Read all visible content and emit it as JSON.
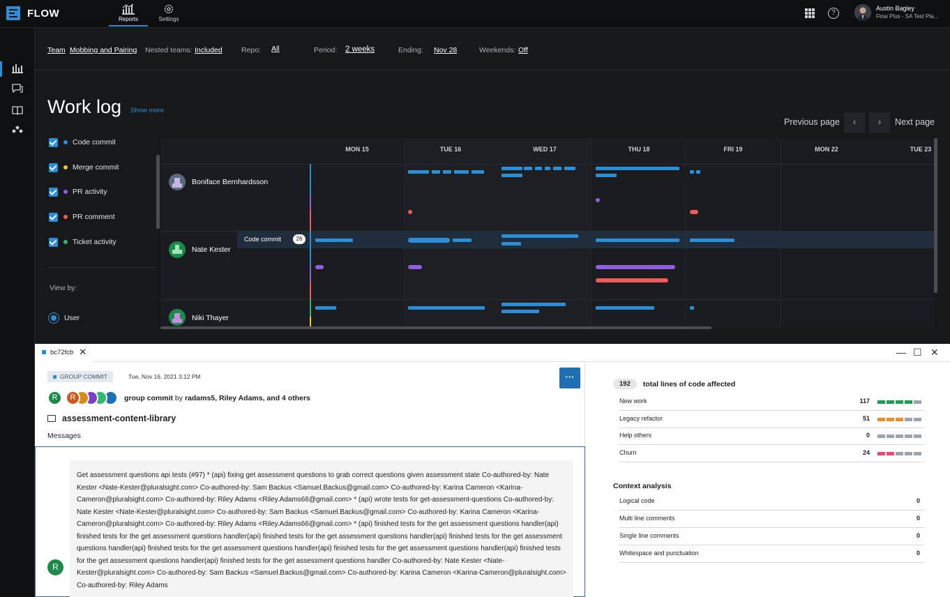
{
  "app": {
    "name": "FLOW"
  },
  "nav": {
    "tabs": [
      {
        "label": "Reports"
      },
      {
        "label": "Settings"
      }
    ]
  },
  "user": {
    "name": "Austin Bagley",
    "subtitle": "Flow Plus - SA Test Pla..."
  },
  "filters": {
    "team_label": "Team",
    "team_value": "Mobbing and Pairing",
    "nested_label": "Nested teams:",
    "nested_value": "Included",
    "repo_label": "Repo:",
    "repo_value": "All",
    "period_label": "Period:",
    "period_value": "2 weeks",
    "ending_label": "Ending:",
    "ending_value": "Nov 28",
    "weekends_label": "Weekends:",
    "weekends_value": "Off"
  },
  "page": {
    "title": "Work log",
    "show_more": "Show more",
    "prev_page": "Previous page",
    "next_page": "Next page",
    "prev_glyph": "‹",
    "next_glyph": "›"
  },
  "legend": [
    {
      "label": "Code commit",
      "color": "#2a8fd6"
    },
    {
      "label": "Merge commit",
      "color": "#f2c230"
    },
    {
      "label": "PR activity",
      "color": "#8e5ee0"
    },
    {
      "label": "PR comment",
      "color": "#ef5a5a"
    },
    {
      "label": "Ticket activity",
      "color": "#2fb86e"
    }
  ],
  "view_by": {
    "label": "View by:",
    "option": "User"
  },
  "days": [
    "MON 15",
    "TUE 16",
    "WED 17",
    "THU 18",
    "FRI 19",
    "MON 22",
    "TUE 23"
  ],
  "users": [
    {
      "name": "Boniface Bernhardsson"
    },
    {
      "name": "Nate Kester"
    },
    {
      "name": "Niki Thayer"
    }
  ],
  "tooltip": {
    "label": "Code commit",
    "count": "26"
  },
  "detail": {
    "tab": "bc72fcb",
    "tab_close": "✕",
    "win_min": "—",
    "win_max": "☐",
    "win_close": "✕",
    "badge": "GROUP COMMIT",
    "date": "Tue, Nov 16, 2021 3:12 PM",
    "more": "···",
    "avatar_letters": [
      "R",
      "R",
      "",
      "",
      "",
      ""
    ],
    "commit_prefix": "group commit",
    "commit_by": "by",
    "commit_authors": "radams5, Riley Adams, and 4 others",
    "repo": "assessment-content-library",
    "messages_label": "Messages",
    "message_avatar": "R",
    "message": "Get assessment questions api tests (#97) * (api) fixing get assessment questions to grab correct questions given assessment state Co-authored-by: Nate Kester <Nate-Kester@pluralsight.com> Co-authored-by: Sam Backus <Samuel.Backus@gmail.com> Co-authored-by: Karina Cameron <Karina-Cameron@pluralsight.com> Co-authored-by: Riley Adams <Riley.Adams66@gmail.com> * (api) wrote tests for get-assessment-questions Co-authored-by: Nate Kester <Nate-Kester@pluralsight.com> Co-authored-by: Sam Backus <Samuel.Backus@gmail.com> Co-authored-by: Karina Cameron <Karina-Cameron@pluralsight.com> Co-authored-by: Riley Adams <Riley.Adams66@gmail.com> * (api) finished tests for the get assessment questions handler(api) finished tests for the get assessment questions handler(api) finished tests for the get assessment questions handler(api) finished tests for the get assessment questions handler(api) finished tests for the get assessment questions handler(api) finished tests for the get assessment questions handler(api) finished tests for the get assessment questions handler(api) finished tests for the get assessment questions handler Co-authored-by: Nate Kester <Nate-Kester@pluralsight.com> Co-authored-by: Sam Backus <Samuel.Backus@gmail.com> Co-authored-by: Karina Cameron <Karina-Cameron@pluralsight.com> Co-authored-by: Riley Adams"
  },
  "stats": {
    "total": "192",
    "total_label": "total lines of code affected",
    "rows": [
      {
        "label": "New work",
        "value": "117",
        "color": "#1e9e55",
        "filled": 4
      },
      {
        "label": "Legacy refactor",
        "value": "51",
        "color": "#f28c28",
        "filled": 3
      },
      {
        "label": "Help others",
        "value": "0",
        "color": "#9aa4b0",
        "filled": 0
      },
      {
        "label": "Churn",
        "value": "24",
        "color": "#e84a78",
        "filled": 2
      }
    ],
    "context_title": "Context analysis",
    "context": [
      {
        "label": "Logical code",
        "value": "0"
      },
      {
        "label": "Multi line comments",
        "value": "0"
      },
      {
        "label": "Single line comments",
        "value": "0"
      },
      {
        "label": "Whitespace and punctuation",
        "value": "0"
      }
    ]
  }
}
